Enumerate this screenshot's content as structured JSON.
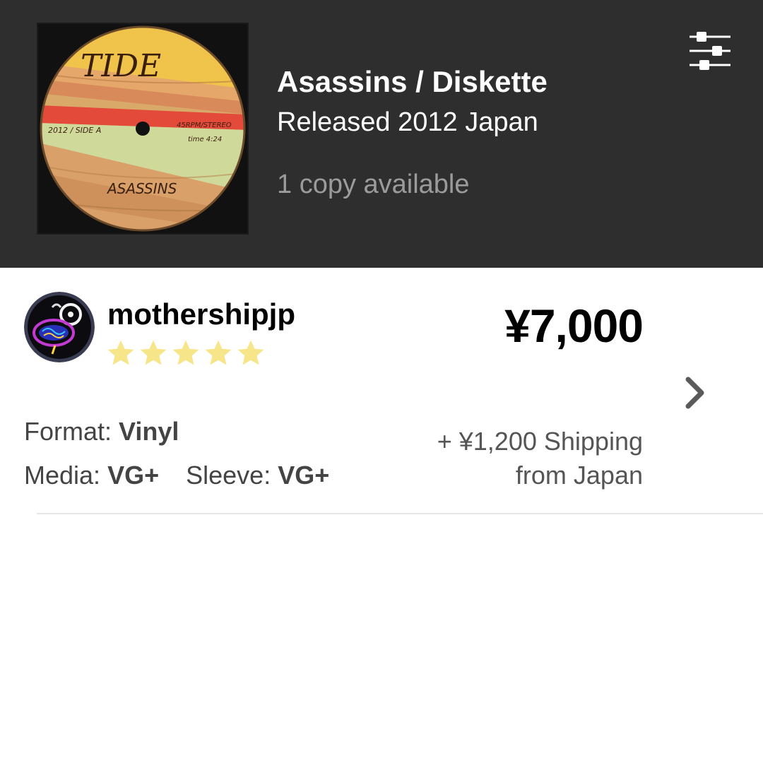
{
  "release": {
    "title": "Asassins / Diskette",
    "released": "Released 2012 Japan",
    "availability": "1 copy available",
    "cover_label": {
      "brand": "TIDE",
      "side": "2012 / SIDE A",
      "rpm": "45RPM/STEREO",
      "time": "time 4:24",
      "track": "ASASSINS"
    }
  },
  "header": {
    "filter_icon": "sliders-icon"
  },
  "listing": {
    "seller": "mothershipjp",
    "rating_stars": 5,
    "price": "¥7,000",
    "format_label": "Format:",
    "format_value": "Vinyl",
    "media_label": "Media:",
    "media_value": "VG+",
    "sleeve_label": "Sleeve:",
    "sleeve_value": "VG+",
    "shipping": "+ ¥1,200 Shipping",
    "ships_from": "from Japan",
    "chevron_icon": "chevron-right-icon"
  },
  "colors": {
    "header_bg": "#2e2e2e",
    "star": "#f7e58a",
    "muted_text": "#9b9b9b"
  }
}
